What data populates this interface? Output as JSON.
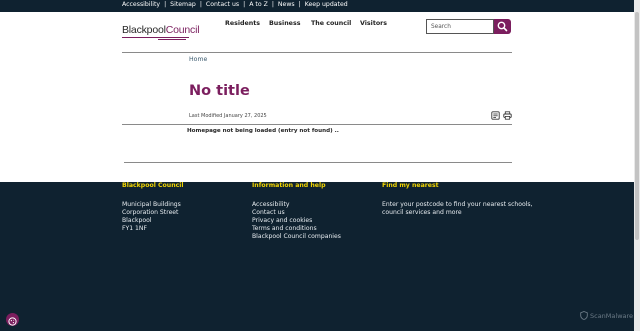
{
  "topbar": {
    "links": [
      "Accessibility",
      "Sitemap",
      "Contact us",
      "A to Z",
      "News",
      "Keep updated"
    ],
    "separator": "|"
  },
  "logo": {
    "part1": "Blackpool",
    "part2": "Council"
  },
  "nav": {
    "residents": "Residents",
    "business": "Business",
    "council": "The council",
    "visitors": "Visitors"
  },
  "search": {
    "placeholder": "Search"
  },
  "breadcrumb": {
    "home": "Home"
  },
  "page": {
    "title": "No title",
    "last_modified": "Last Modified January 27, 2025",
    "message": "Homepage not being loaded (entry not found) .."
  },
  "footer": {
    "col1": {
      "heading": "Blackpool Council",
      "lines": [
        "Municipal Buildings",
        "Corporation Street",
        "Blackpool",
        "FY1 1NF"
      ]
    },
    "col2": {
      "heading": "Information and help",
      "lines": [
        "Accessibility",
        "Contact us",
        "Privacy and cookies",
        "Terms and conditions",
        "Blackpool Council companies"
      ]
    },
    "col3": {
      "heading": "Find my nearest",
      "lines": [
        "Enter your postcode to find your nearest schools,",
        "council services and more"
      ]
    }
  },
  "badge": {
    "label": "ScanMalware"
  },
  "colors": {
    "brand_purple": "#7b1e5e",
    "navy": "#0f2230",
    "footer_heading": "#f2d500"
  }
}
